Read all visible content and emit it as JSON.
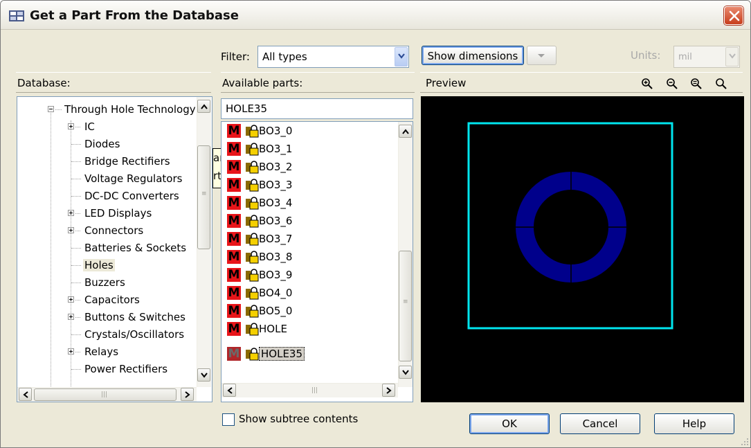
{
  "window": {
    "title": "Get a Part From the Database"
  },
  "filter": {
    "label": "Filter:",
    "value": "All types"
  },
  "toolbar": {
    "show_dimensions_label": "Show dimensions",
    "units_label": "Units:",
    "units_value": "mil"
  },
  "database": {
    "label": "Database:",
    "root_item": "Through Hole Technology",
    "items": [
      "IC",
      "Diodes",
      "Bridge Rectifiers",
      "Voltage Regulators",
      "DC-DC Converters",
      "LED Displays",
      "Connectors",
      "Batteries & Sockets",
      "Holes",
      "Buzzers",
      "Capacitors",
      "Buttons & Switches",
      "Crystals/Oscillators",
      "Relays",
      "Power Rectifiers"
    ],
    "selected_item": "Holes",
    "tooltip_fragment": [
      "ar",
      "rt"
    ]
  },
  "parts": {
    "label": "Available parts:",
    "search_value": "HOLE35",
    "items": [
      "BO3_0",
      "BO3_1",
      "BO3_2",
      "BO3_3",
      "BO3_4",
      "BO3_6",
      "BO3_7",
      "BO3_8",
      "BO3_9",
      "BO4_0",
      "BO5_0",
      "HOLE",
      "HOLE35"
    ],
    "selected_item": "HOLE35",
    "m_glyph": "M"
  },
  "preview": {
    "label": "Preview",
    "outline_color": "#00e5ee",
    "pad_color": "#00008b",
    "background": "#000000"
  },
  "options": {
    "show_subtree_label": "Show subtree contents",
    "show_subtree_checked": false
  },
  "buttons": {
    "ok": "OK",
    "cancel": "Cancel",
    "help": "Help"
  },
  "icons": {
    "title": "database-icon",
    "close": "close-icon",
    "zoom_in": "zoom-in-icon",
    "zoom_out": "zoom-out-icon",
    "zoom_fit": "zoom-fit-icon",
    "zoom_actual": "zoom-actual-icon",
    "lock": "lock-icon",
    "component": "component-m-icon"
  }
}
